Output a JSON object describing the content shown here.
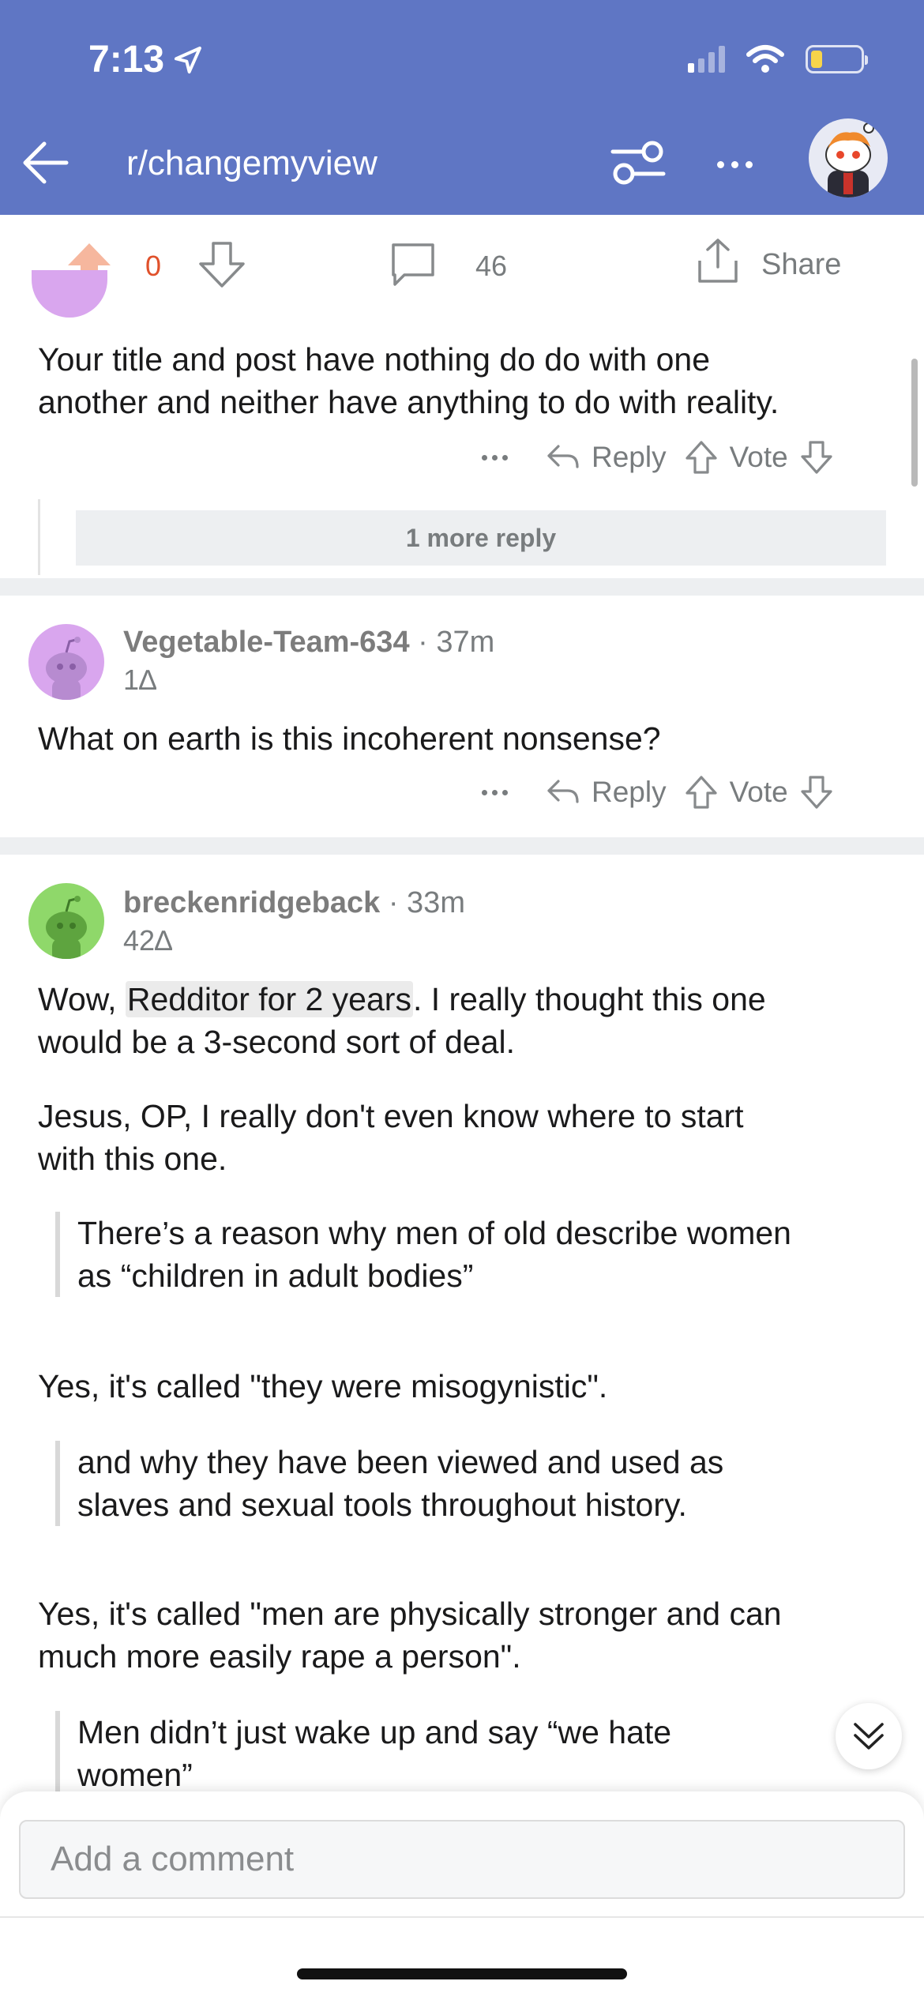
{
  "status_bar": {
    "time": "7:13"
  },
  "nav": {
    "title": "r/changemyview",
    "icons": [
      "back-arrow-icon",
      "filter-icon",
      "more-icon",
      "avatar"
    ]
  },
  "post_actions": {
    "score": "0",
    "comment_count": "46",
    "share_label": "Share"
  },
  "comments": [
    {
      "partial_meta": "...",
      "text_lines": [
        "Your title and post have nothing do do with one",
        "another and neither have anything to do with reality."
      ],
      "actions": {
        "reply": "Reply",
        "vote": "Vote"
      },
      "more_replies": "1 more reply"
    },
    {
      "username": "Vegetable-Team-634",
      "time": "37m",
      "karma": "1∆",
      "text": "What on earth is this incoherent nonsense?",
      "actions": {
        "reply": "Reply",
        "vote": "Vote"
      },
      "avatar_color": "#d9a6ee"
    },
    {
      "username": "breckenridgeback",
      "time": "33m",
      "karma": "42∆",
      "avatar_color": "#8fd86a",
      "p1_pre": "Wow, ",
      "p1_highlight": "Redditor for 2 years",
      "p1_line1_post": ". I really thought this one",
      "p1_line2": "would be a 3-second sort of deal.",
      "p2_line1": "Jesus, OP, I really don't even know where to start",
      "p2_line2": "with this one.",
      "q1_line1": "There’s a reason why men of old describe women",
      "q1_line2": "as “children in adult bodies”",
      "p3": "Yes, it's called \"they were misogynistic\".",
      "q2_line1": "and why they have been viewed and used as",
      "q2_line2": "slaves and sexual tools throughout history.",
      "p4_line1": "Yes, it's called \"men are physically stronger and can",
      "p4_line2": "much more easily rape a person\".",
      "q3_line1": "Men didn’t just wake up and say “we hate",
      "q3_line2": "women”"
    }
  ],
  "composer": {
    "placeholder": "Add a comment"
  }
}
